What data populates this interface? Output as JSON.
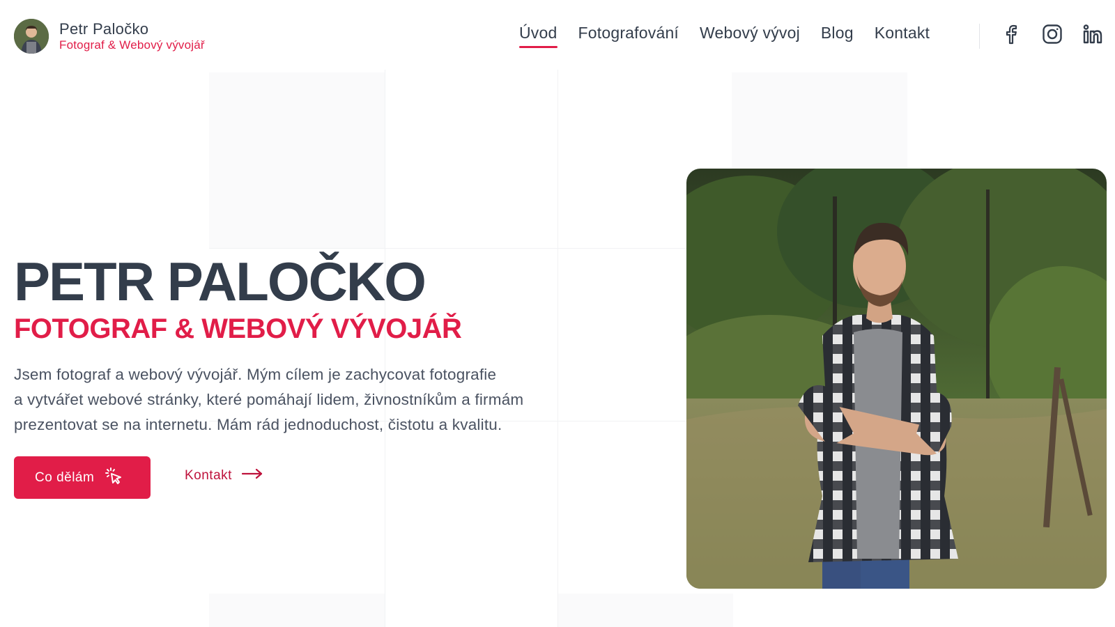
{
  "header": {
    "brand_name": "Petr Paločko",
    "brand_subtitle": "Fotograf & Webový vývojář",
    "avatar_icon": "portrait-avatar"
  },
  "nav": {
    "items": [
      {
        "label": "Úvod",
        "active": true
      },
      {
        "label": "Fotografování",
        "active": false
      },
      {
        "label": "Webový vývoj",
        "active": false
      },
      {
        "label": "Blog",
        "active": false
      },
      {
        "label": "Kontakt",
        "active": false
      }
    ],
    "social": [
      {
        "icon": "facebook-icon"
      },
      {
        "icon": "instagram-icon"
      },
      {
        "icon": "linkedin-icon"
      }
    ]
  },
  "hero": {
    "title": "PETR PALOČKO",
    "subtitle": "FOTOGRAF & WEBOVÝ VÝVOJÁŘ",
    "text_line1": "Jsem fotograf a webový vývojář. Mým cílem je zachycovat fotografie",
    "text_line2": "a vytvářet webové stránky, které pomáhají lidem, živnostníkům a firmám",
    "text_line3": "prezentovat se na internetu. Mám rád jednoduchost, čistotu a kvalitu.",
    "primary_button": "Co dělám",
    "primary_button_icon": "cursor-click-icon",
    "secondary_link": "Kontakt",
    "secondary_link_icon": "arrow-right-icon"
  },
  "colors": {
    "accent": "#e11d48",
    "text_dark": "#333d4b",
    "text_body": "#4a5261"
  }
}
